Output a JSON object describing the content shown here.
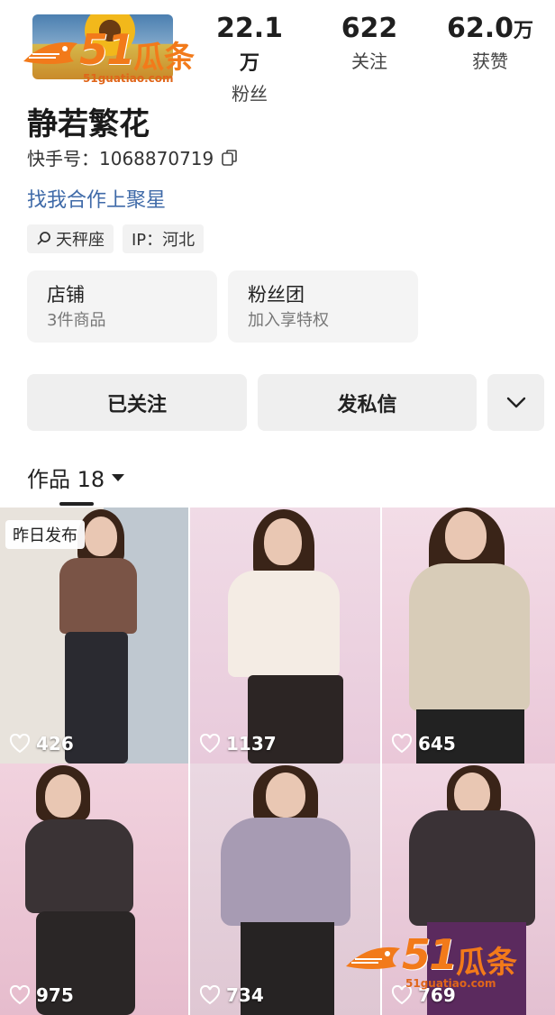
{
  "header": {
    "stats": [
      {
        "value": "22.1",
        "unit": "万",
        "label": "粉丝"
      },
      {
        "value": "622",
        "unit": "",
        "label": "关注"
      },
      {
        "value": "62.0",
        "unit": "万",
        "label": "获赞"
      }
    ]
  },
  "profile": {
    "name": "静若繁花",
    "uid": "快手号：1068870719",
    "cooperation_link": "找我合作上聚星",
    "tags": [
      {
        "icon": "search-icon",
        "label": "天秤座"
      },
      {
        "label": "IP：河北"
      }
    ]
  },
  "cards": [
    {
      "title": "店铺",
      "subtitle": "3件商品"
    },
    {
      "title": "粉丝团",
      "subtitle": "加入享特权"
    }
  ],
  "actions": {
    "follow_label": "已关注",
    "message_label": "发私信",
    "more_icon": "chevron-down-icon"
  },
  "works": {
    "tab_label": "作品 18"
  },
  "videos": [
    {
      "likes": "426",
      "badge": "昨日发布"
    },
    {
      "likes": "1137"
    },
    {
      "likes": "645"
    },
    {
      "likes": "975"
    },
    {
      "likes": "734"
    },
    {
      "likes": "769"
    }
  ],
  "watermark": {
    "number": "51",
    "text": "瓜条",
    "url": "51guatiao.com",
    "color": "#f27a1a"
  }
}
